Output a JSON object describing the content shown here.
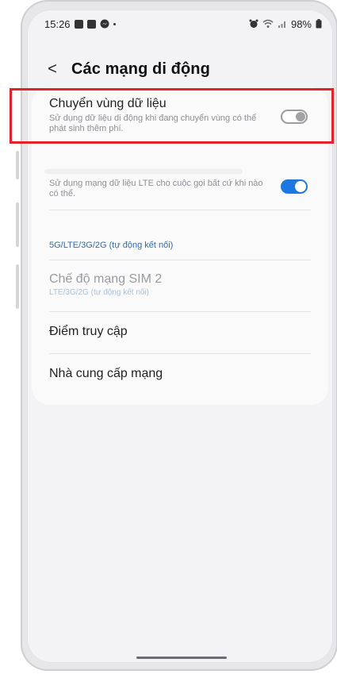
{
  "status_bar": {
    "time": "15:26",
    "battery": "98%",
    "icons_left": [
      "gallery-icon",
      "calendar-icon",
      "messenger-icon",
      "dot-icon"
    ],
    "icons_right": [
      "alarm-icon",
      "wifi-icon",
      "signal-icon",
      "battery-icon"
    ]
  },
  "header": {
    "back_icon": "chevron-left-icon",
    "back_glyph": "<",
    "title": "Các mạng di động"
  },
  "settings": {
    "data_roaming": {
      "title": "Chuyển vùng dữ liệu",
      "subtitle_line1": "Sử dụng dữ liệu di động khi đang chuyển vùng có thể",
      "subtitle_line2": "phát sinh thêm phí.",
      "toggle_state": "off"
    },
    "lte_calls": {
      "subtitle_line1": "Sử dụng mạng dữ liệu LTE cho cuộc gọi bất cứ khi nào",
      "subtitle_line2": "có thể.",
      "toggle_state": "on"
    },
    "network_mode_value": "5G/LTE/3G/2G (tự động kết nối)",
    "sim2_mode": {
      "title": "Chế độ mạng SIM 2",
      "subtitle": "LTE/3G/2G (tự động kết nối)"
    },
    "access_points": "Điểm truy cập",
    "network_operators": "Nhà cung cấp mạng"
  },
  "colors": {
    "toggle_on": "#1b78e2",
    "highlight_border": "#e1242c",
    "link_blue": "#2f6db5"
  }
}
